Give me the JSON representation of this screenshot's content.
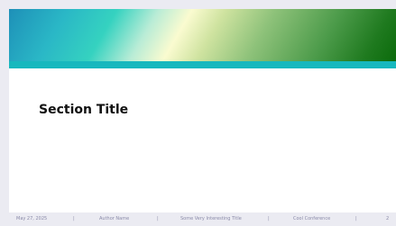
{
  "slide": {
    "section_title": "Section Title"
  },
  "footer": {
    "date": "May 27, 2025",
    "author": "Author Name",
    "title": "Some Very Interesting Title",
    "conference": "Cool Conference",
    "page_number": "2",
    "separator": "|"
  },
  "colors": {
    "page_background": "#ebebf2",
    "slide_background": "#ffffff",
    "header_stripe": "#17b8be",
    "gradient_start": "#1e90b8",
    "gradient_end": "#0b6b0b",
    "footer_text": "#8a8aa8"
  }
}
